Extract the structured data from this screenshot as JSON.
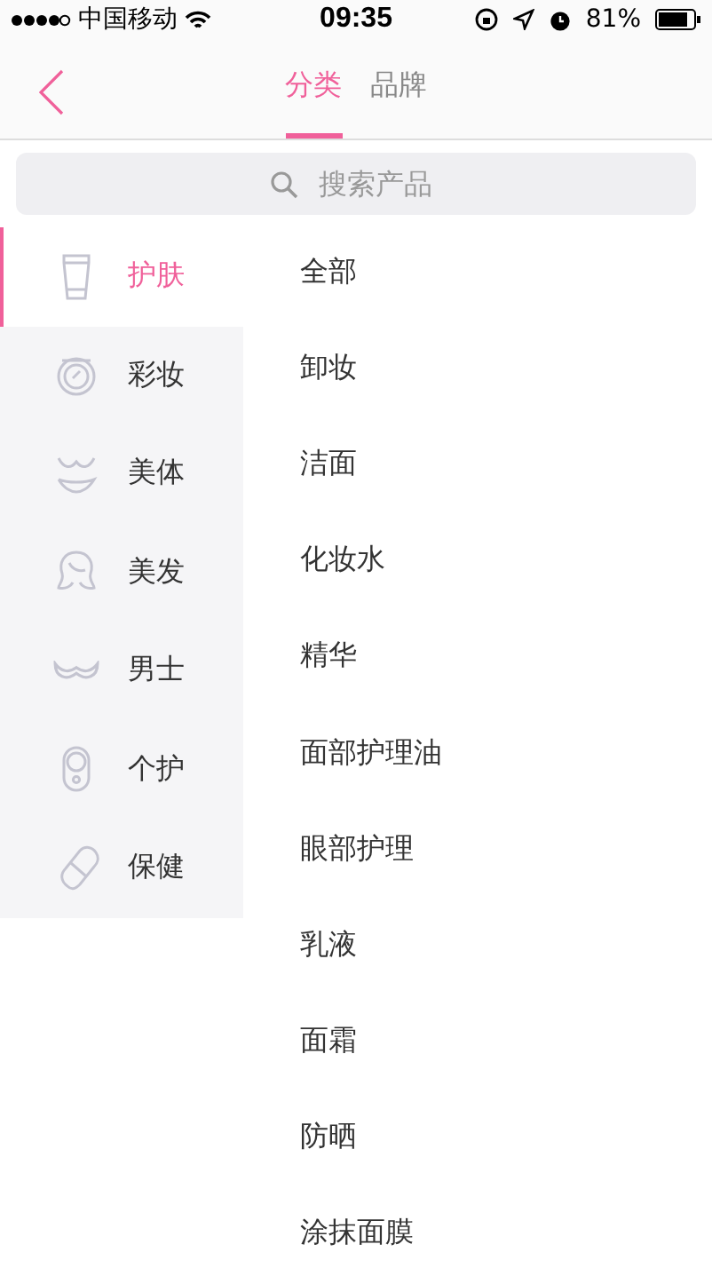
{
  "status_bar": {
    "carrier": "中国移动",
    "time": "09:35",
    "battery_text": "81%"
  },
  "nav": {
    "tabs": [
      {
        "label": "分类",
        "selected": true
      },
      {
        "label": "品牌",
        "selected": false
      }
    ]
  },
  "search": {
    "placeholder": "搜索产品"
  },
  "sidebar": {
    "items": [
      {
        "label": "护肤",
        "selected": true
      },
      {
        "label": "彩妆",
        "selected": false
      },
      {
        "label": "美体",
        "selected": false
      },
      {
        "label": "美发",
        "selected": false
      },
      {
        "label": "男士",
        "selected": false
      },
      {
        "label": "个护",
        "selected": false
      },
      {
        "label": "保健",
        "selected": false
      }
    ]
  },
  "subcategories": [
    "全部",
    "卸妆",
    "洁面",
    "化妆水",
    "精华",
    "面部护理油",
    "眼部护理",
    "乳液",
    "面霜",
    "防晒",
    "涂抹面膜"
  ]
}
